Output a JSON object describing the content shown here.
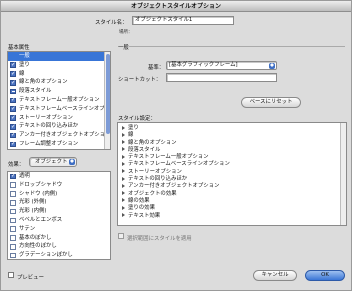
{
  "window": {
    "title": "オブジェクトスタイルオプション"
  },
  "style_name": {
    "label": "スタイル名：",
    "value": "オブジェクトスタイル1",
    "location_label": "場所："
  },
  "basic_attributes": {
    "heading": "基本属性",
    "items": [
      {
        "label": "一般",
        "state": "none",
        "selected": true
      },
      {
        "label": "塗り",
        "state": "on"
      },
      {
        "label": "線",
        "state": "on"
      },
      {
        "label": "線と角のオプション",
        "state": "on"
      },
      {
        "label": "段落スタイル",
        "state": "dash"
      },
      {
        "label": "テキストフレーム一般オプション",
        "state": "on"
      },
      {
        "label": "テキストフレームベースラインオプション",
        "state": "on"
      },
      {
        "label": "ストーリーオプション",
        "state": "on"
      },
      {
        "label": "テキストの回り込みほか",
        "state": "on"
      },
      {
        "label": "アンカー付きオブジェクトオプション",
        "state": "on"
      },
      {
        "label": "フレーム調整オプション",
        "state": "on"
      }
    ]
  },
  "effects": {
    "label": "効果：",
    "target": "オブジェクト",
    "items": [
      {
        "label": "透明",
        "state": "on"
      },
      {
        "label": "ドロップシャドウ",
        "state": "off"
      },
      {
        "label": "シャドウ (内側)",
        "state": "off"
      },
      {
        "label": "光彩 (外側)",
        "state": "off"
      },
      {
        "label": "光彩 (内側)",
        "state": "off"
      },
      {
        "label": "ベベルとエンボス",
        "state": "off"
      },
      {
        "label": "サテン",
        "state": "off"
      },
      {
        "label": "基本のぼかし",
        "state": "off"
      },
      {
        "label": "方向性のぼかし",
        "state": "off"
      },
      {
        "label": "グラデーションぼかし",
        "state": "off"
      }
    ]
  },
  "general": {
    "heading": "一般",
    "base_label": "基準：",
    "base_value": "[基本グラフィックフレーム]",
    "shortcut_label": "ショートカット：",
    "shortcut_value": "",
    "reset_button": "ベースにリセット",
    "settings_label": "スタイル設定：",
    "settings_items": [
      "塗り",
      "線",
      "線と角のオプション",
      "段落スタイル",
      "テキストフレーム一般オプション",
      "テキストフレームベースラインオプション",
      "ストーリーオプション",
      "テキストの回り込みほか",
      "アンカー付きオブジェクトオプション",
      "オブジェクトの効果",
      "線の効果",
      "塗りの効果",
      "テキスト効果"
    ]
  },
  "apply_to_selection": {
    "label": "選択範囲にスタイルを適用",
    "checked": false
  },
  "preview": {
    "label": "プレビュー",
    "checked": false
  },
  "buttons": {
    "cancel": "キャンセル",
    "ok": "OK"
  }
}
